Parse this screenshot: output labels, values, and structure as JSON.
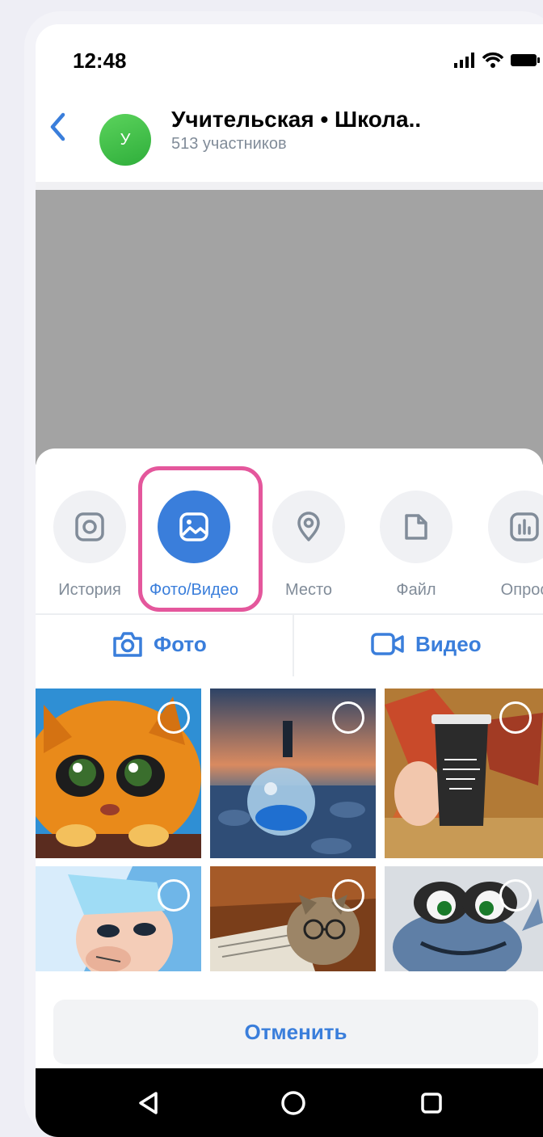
{
  "status_bar": {
    "time": "12:48"
  },
  "header": {
    "avatar_letter": "У",
    "title": "Учительская • Школа..",
    "subtitle": "513 участников"
  },
  "attach_options": [
    {
      "label": "История",
      "icon": "story-camera-icon"
    },
    {
      "label": "Фото/Видео",
      "icon": "gallery-icon",
      "active": true
    },
    {
      "label": "Место",
      "icon": "location-pin-icon"
    },
    {
      "label": "Файл",
      "icon": "file-icon"
    },
    {
      "label": "Опрос",
      "icon": "poll-icon"
    }
  ],
  "mode_buttons": {
    "photo": "Фото",
    "video": "Видео"
  },
  "cancel_label": "Отменить",
  "colors": {
    "accent": "#3a7edb",
    "highlight": "#e4579c",
    "avatar": "#3fbf48"
  }
}
